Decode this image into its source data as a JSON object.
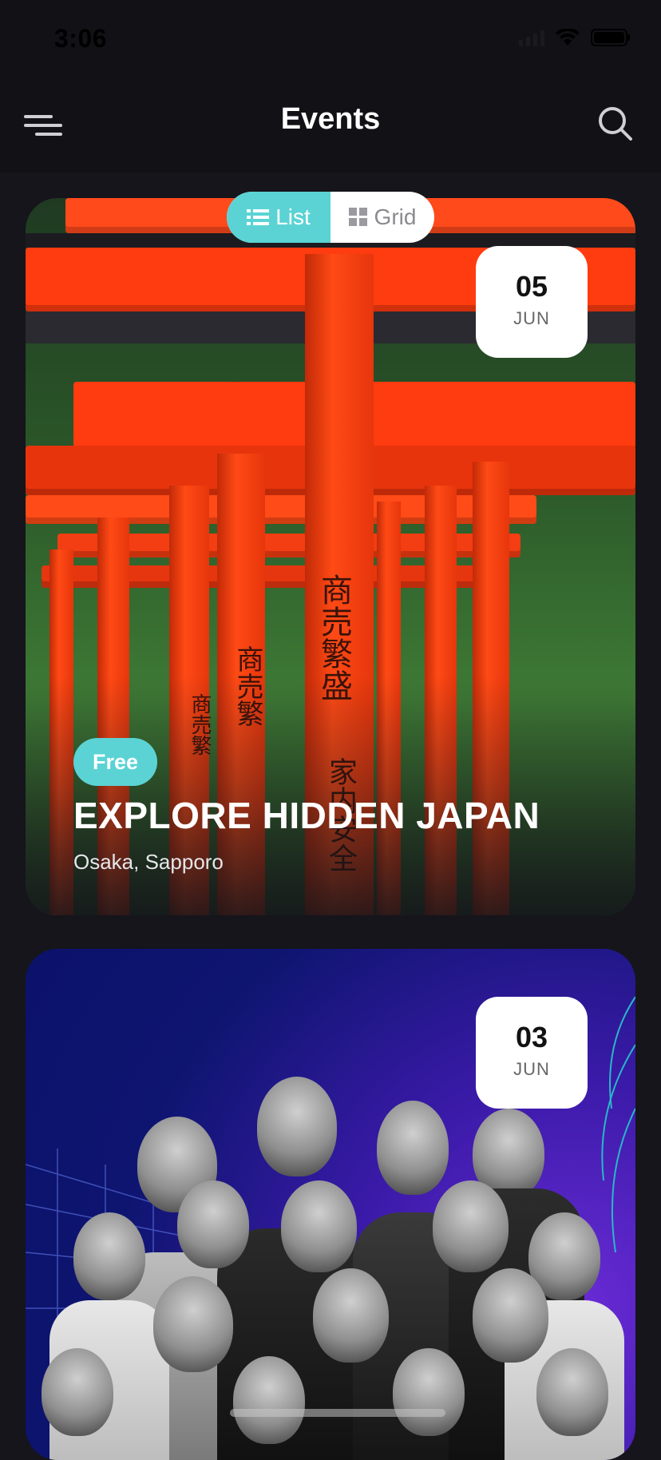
{
  "status": {
    "time": "3:06"
  },
  "header": {
    "title": "Events"
  },
  "view_toggle": {
    "list_label": "List",
    "grid_label": "Grid",
    "selected": "List"
  },
  "events": [
    {
      "day": "05",
      "month": "JUN",
      "tag": "Free",
      "title": "EXPLORE HIDDEN JAPAN",
      "location": "Osaka, Sapporo"
    },
    {
      "day": "03",
      "month": "JUN"
    }
  ],
  "colors": {
    "accent": "#5bd3d4",
    "background": "#15151b",
    "header": "#121216"
  },
  "icons": {
    "menu": "menu-icon",
    "search": "search-icon",
    "list": "list-icon",
    "grid": "grid-icon"
  }
}
